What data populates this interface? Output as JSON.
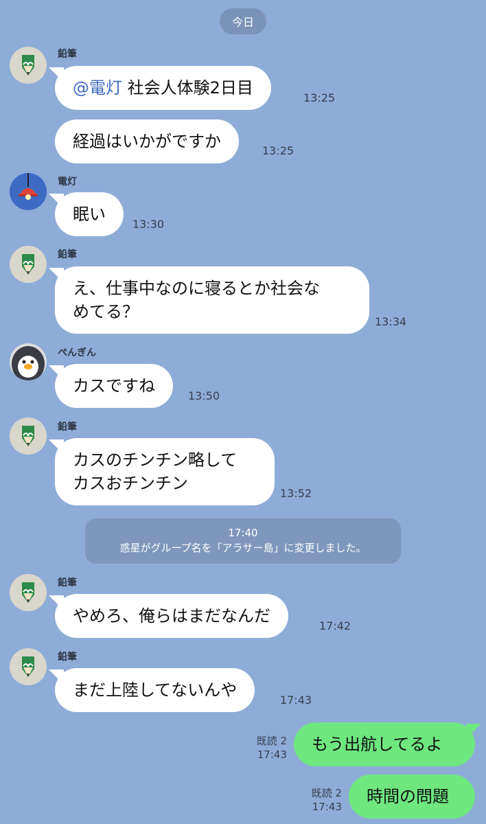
{
  "date_divider": "今日",
  "messages": [
    {
      "sender": "鉛筆",
      "mention": "@電灯",
      "text": " 社会人体験2日目",
      "time": "13:25"
    },
    {
      "text": "経過はいかがですか",
      "time": "13:25"
    },
    {
      "sender": "電灯",
      "text": "眠い",
      "time": "13:30"
    },
    {
      "sender": "鉛筆",
      "text_line1": "え、仕事中なのに寝るとか社会な",
      "text_line2": "めてる？",
      "time": "13:34"
    },
    {
      "sender": "ぺんぎん",
      "text": "カスですね",
      "time": "13:50"
    },
    {
      "sender": "鉛筆",
      "text_line1": "カスのチンチン略して",
      "text_line2": "カスおチンチン",
      "time": "13:52"
    }
  ],
  "system_notice": {
    "time": "17:40",
    "text": "惑星がグループ名を「アラサー島」に変更しました。"
  },
  "messages_after": [
    {
      "sender": "鉛筆",
      "text": "やめろ、俺らはまだなんだ",
      "time": "17:42"
    },
    {
      "sender": "鉛筆",
      "text": "まだ上陸してないんや",
      "time": "17:43"
    }
  ],
  "outgoing": [
    {
      "text": "もう出航してるよ",
      "read": "既読 2",
      "time": "17:43"
    },
    {
      "text": "時間の問題",
      "read": "既読 2",
      "time": "17:43"
    }
  ],
  "colors": {
    "background": "#8eacd8",
    "incoming_bubble": "#ffffff",
    "outgoing_bubble": "#6ee77f",
    "mention": "#3d6ac2"
  },
  "icons": {
    "pencil_avatar": "pencil-avatar-icon",
    "lamp_avatar": "lamp-avatar-icon",
    "penguin_avatar": "penguin-avatar-icon"
  }
}
